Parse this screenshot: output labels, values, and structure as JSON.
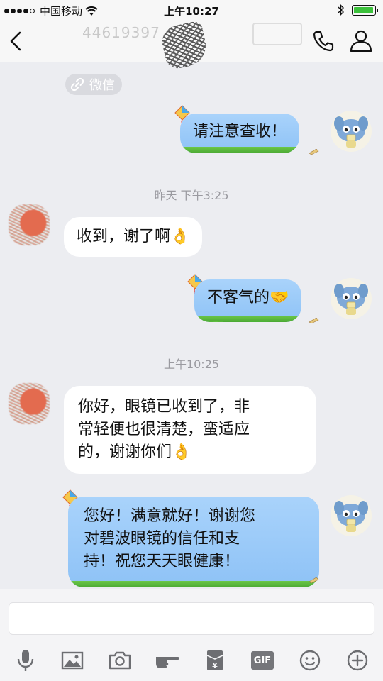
{
  "status_bar": {
    "carrier": "中国移动",
    "time": "上午10:27",
    "battery_percent": 95,
    "battery_color": "#3cc13b"
  },
  "nav": {
    "title_fragment": "44619397",
    "back_icon": "chevron-left-icon",
    "call_icon": "phone-icon",
    "profile_icon": "person-icon"
  },
  "chat": {
    "link_chip": {
      "label": "微信",
      "icon": "link-icon"
    },
    "messages": [
      {
        "side": "out",
        "text": "请注意查收！"
      },
      {
        "type": "time",
        "text": "昨天 下午3:25"
      },
      {
        "side": "in",
        "text": "收到，谢了啊",
        "emoji": "👌"
      },
      {
        "side": "out",
        "text": "不客气的",
        "emoji": "🤝"
      },
      {
        "type": "time",
        "text": "上午10:25"
      },
      {
        "side": "in",
        "lines": [
          "你好，眼镜已收到了，非",
          "常轻便也很清楚，蛮适应",
          "的，谢谢你们"
        ],
        "emoji": "👌"
      },
      {
        "side": "out",
        "lines": [
          "您好！满意就好！谢谢您",
          "对碧波眼镜的信任和支",
          "持！祝您天天眼健康！"
        ]
      }
    ],
    "bubble_out_color": "#9ccaf8",
    "bubble_in_color": "#ffffff"
  },
  "input": {
    "placeholder": ""
  },
  "toolbar": {
    "items": [
      "microphone-icon",
      "image-icon",
      "camera-icon",
      "hand-pointer-icon",
      "red-packet-icon",
      "gif-icon",
      "emoji-icon",
      "plus-icon"
    ],
    "gif_label": "GIF"
  }
}
